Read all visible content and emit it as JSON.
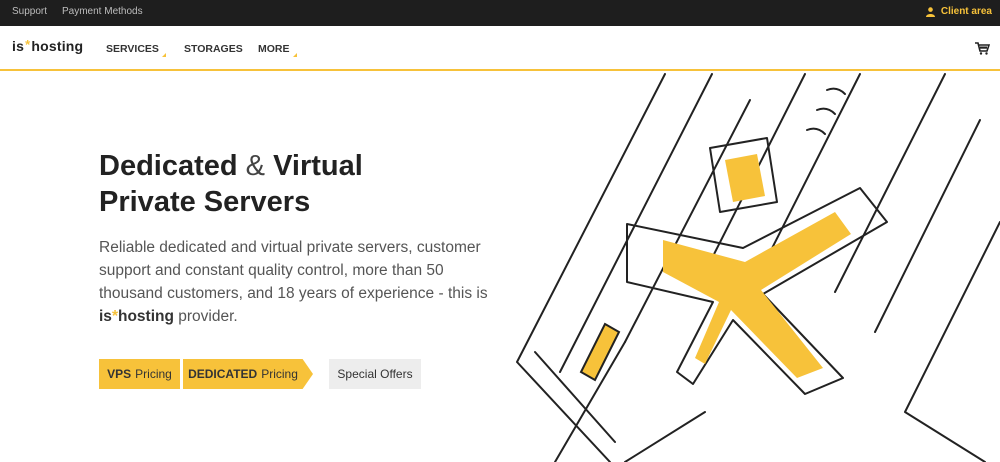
{
  "topbar": {
    "support": "Support",
    "payment_methods": "Payment Methods",
    "client_area": "Client area"
  },
  "nav": {
    "logo_left": "is",
    "logo_star": "*",
    "logo_right": "hosting",
    "services": "SERVICES",
    "storages": "STORAGES",
    "more": "MORE"
  },
  "hero": {
    "title_part1": "Dedicated",
    "title_amp": "&",
    "title_part2": "Virtual",
    "title_line2": "Private Servers",
    "lead_text": "Reliable dedicated and virtual private servers, customer support and constant quality control, more than 50 thousand customers, and 18 years of experience - this is",
    "lead_brand_left": "is",
    "lead_brand_star": "*",
    "lead_brand_right": "hosting",
    "lead_end": "provider."
  },
  "buttons": {
    "vps_bold": "VPS",
    "vps_rest": "Pricing",
    "dedicated_bold": "DEDICATED",
    "dedicated_rest": "Pricing",
    "special": "Special Offers"
  },
  "colors": {
    "accent": "#f7c23a",
    "topbar_bg": "#1e1e1e",
    "secondary_button": "#ededed"
  },
  "icons": {
    "client": "user-icon",
    "cart": "cart-icon"
  }
}
